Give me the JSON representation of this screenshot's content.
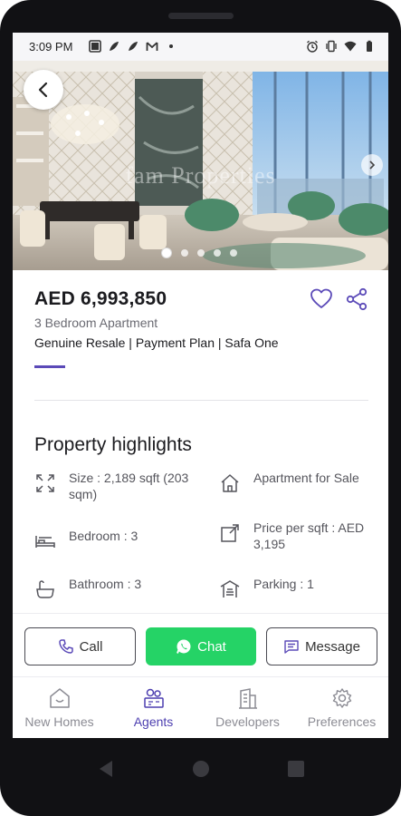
{
  "status_bar": {
    "time": "3:09 PM",
    "left_icons": [
      "photo-icon",
      "bird-icon",
      "bird-icon",
      "mail-icon",
      "dot-icon"
    ],
    "right_icons": [
      "alarm-icon",
      "vibrate-icon",
      "wifi-icon",
      "battery-icon"
    ]
  },
  "hero": {
    "watermark": "fam Properties",
    "image_count": 5,
    "active_index": 0
  },
  "listing": {
    "price": "AED 6,993,850",
    "property_type": "3 Bedroom Apartment",
    "tags": "Genuine Resale | Payment Plan | Safa One"
  },
  "highlights": {
    "title": "Property highlights",
    "items": [
      {
        "icon": "expand-icon",
        "text": "Size : 2,189 sqft (203 sqm)"
      },
      {
        "icon": "house-icon",
        "text": "Apartment for Sale"
      },
      {
        "icon": "bed-icon",
        "text": "Bedroom : 3"
      },
      {
        "icon": "price-tag-icon",
        "text": "Price per sqft : AED 3,195"
      },
      {
        "icon": "bathtub-icon",
        "text": "Bathroom : 3"
      },
      {
        "icon": "parking-icon",
        "text": "Parking : 1"
      }
    ]
  },
  "actions": {
    "call": "Call",
    "chat": "Chat",
    "message": "Message"
  },
  "bottom_nav": {
    "items": [
      {
        "label": "New Homes",
        "icon": "home-icon",
        "active": false
      },
      {
        "label": "Agents",
        "icon": "agents-icon",
        "active": true
      },
      {
        "label": "Developers",
        "icon": "building-icon",
        "active": false
      },
      {
        "label": "Preferences",
        "icon": "gear-icon",
        "active": false
      }
    ]
  },
  "colors": {
    "accent": "#4d3fb0",
    "whatsapp_green": "#25d366",
    "text_primary": "#1b1b1f",
    "text_secondary": "#6a6a72"
  }
}
